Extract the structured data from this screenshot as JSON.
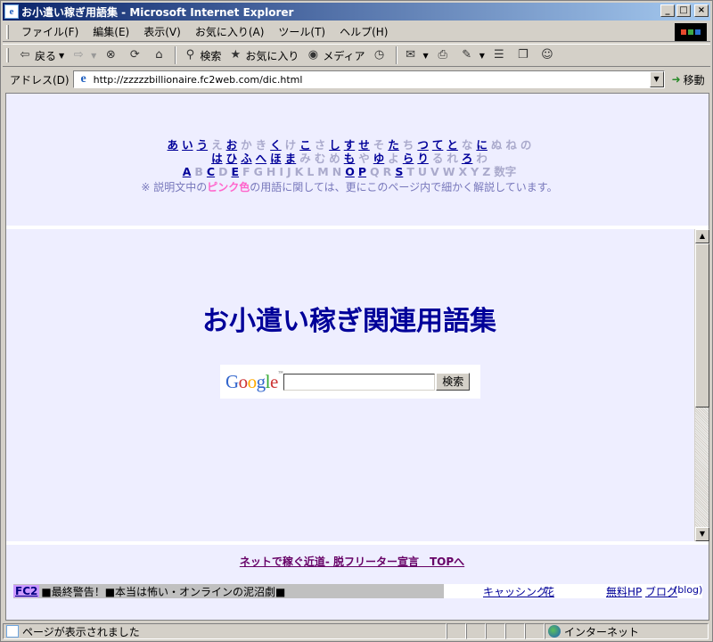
{
  "window": {
    "title": "お小遣い稼ぎ用語集 - Microsoft Internet Explorer",
    "icon": "ie-page-icon",
    "buttons": [
      "_",
      "□",
      "×"
    ]
  },
  "menubar": {
    "items": [
      "ファイル(F)",
      "編集(E)",
      "表示(V)",
      "お気に入り(A)",
      "ツール(T)",
      "ヘルプ(H)"
    ]
  },
  "toolbar": {
    "back": "戻る",
    "search": "検索",
    "favorites": "お気に入り",
    "media": "メディア"
  },
  "address": {
    "label": "アドレス(D)",
    "url": "http://zzzzzbillionaire.fc2web.com/dic.html",
    "go": "移動"
  },
  "nav": {
    "row1": [
      {
        "t": "あ",
        "on": true
      },
      {
        "t": "い",
        "on": true
      },
      {
        "t": "う",
        "on": true
      },
      {
        "t": "え",
        "on": false
      },
      {
        "t": "お",
        "on": true
      },
      {
        "t": "か",
        "on": false
      },
      {
        "t": "き",
        "on": false
      },
      {
        "t": "く",
        "on": true
      },
      {
        "t": "け",
        "on": false
      },
      {
        "t": "こ",
        "on": true
      },
      {
        "t": "さ",
        "on": false
      },
      {
        "t": "し",
        "on": true
      },
      {
        "t": "す",
        "on": true
      },
      {
        "t": "せ",
        "on": true
      },
      {
        "t": "そ",
        "on": false
      },
      {
        "t": "た",
        "on": true
      },
      {
        "t": "ち",
        "on": false
      },
      {
        "t": "つ",
        "on": true
      },
      {
        "t": "て",
        "on": true
      },
      {
        "t": "と",
        "on": true
      },
      {
        "t": "な",
        "on": false
      },
      {
        "t": "に",
        "on": true
      },
      {
        "t": "ぬ",
        "on": false
      },
      {
        "t": "ね",
        "on": false
      },
      {
        "t": "の",
        "on": false
      }
    ],
    "row2": [
      {
        "t": "は",
        "on": true
      },
      {
        "t": "ひ",
        "on": true
      },
      {
        "t": "ふ",
        "on": true
      },
      {
        "t": "へ",
        "on": true
      },
      {
        "t": "ほ",
        "on": true
      },
      {
        "t": "ま",
        "on": true
      },
      {
        "t": "み",
        "on": false
      },
      {
        "t": "む",
        "on": false
      },
      {
        "t": "め",
        "on": false
      },
      {
        "t": "も",
        "on": true
      },
      {
        "t": "や",
        "on": false
      },
      {
        "t": "ゆ",
        "on": true
      },
      {
        "t": "よ",
        "on": false
      },
      {
        "t": "ら",
        "on": true
      },
      {
        "t": "り",
        "on": true
      },
      {
        "t": "る",
        "on": false
      },
      {
        "t": "れ",
        "on": false
      },
      {
        "t": "ろ",
        "on": true
      },
      {
        "t": "わ",
        "on": false
      }
    ],
    "row3": [
      {
        "t": "A",
        "on": true
      },
      {
        "t": "B",
        "on": false
      },
      {
        "t": "C",
        "on": true
      },
      {
        "t": "D",
        "on": false
      },
      {
        "t": "E",
        "on": true
      },
      {
        "t": "F",
        "on": false
      },
      {
        "t": "G",
        "on": false
      },
      {
        "t": "H",
        "on": false
      },
      {
        "t": "I",
        "on": false
      },
      {
        "t": "J",
        "on": false
      },
      {
        "t": "K",
        "on": false
      },
      {
        "t": "L",
        "on": false
      },
      {
        "t": "M",
        "on": false
      },
      {
        "t": "N",
        "on": false
      },
      {
        "t": "O",
        "on": true
      },
      {
        "t": "P",
        "on": true
      },
      {
        "t": "Q",
        "on": false
      },
      {
        "t": "R",
        "on": false
      },
      {
        "t": "S",
        "on": true
      },
      {
        "t": "T",
        "on": false
      },
      {
        "t": "U",
        "on": false
      },
      {
        "t": "V",
        "on": false
      },
      {
        "t": "W",
        "on": false
      },
      {
        "t": "X",
        "on": false
      },
      {
        "t": "Y",
        "on": false
      },
      {
        "t": "Z",
        "on": false
      },
      {
        "t": "数字",
        "on": false
      }
    ],
    "note_prefix": "※ 説明文中の",
    "note_pink": "ピンク色",
    "note_suffix": "の用語に関しては、更にこのページ内で細かく解説しています。"
  },
  "main": {
    "title": "お小遣い稼ぎ関連用語集",
    "google_logo": "Google",
    "google_tm": "™",
    "search_value": "",
    "search_button": "検索"
  },
  "footer": {
    "link": "ネットで稼ぐ近道- 脱フリーター宣言　TOPへ",
    "fc2_logo": "FC2",
    "ad_text": "■最終警告！■本当は怖い・オンラインの泥沼劇■",
    "links": [
      "キャッシング",
      "花",
      "無料HP",
      "ブログ"
    ],
    "blog_suffix": "(blog)"
  },
  "statusbar": {
    "message": "ページが表示されました",
    "zone": "インターネット"
  }
}
